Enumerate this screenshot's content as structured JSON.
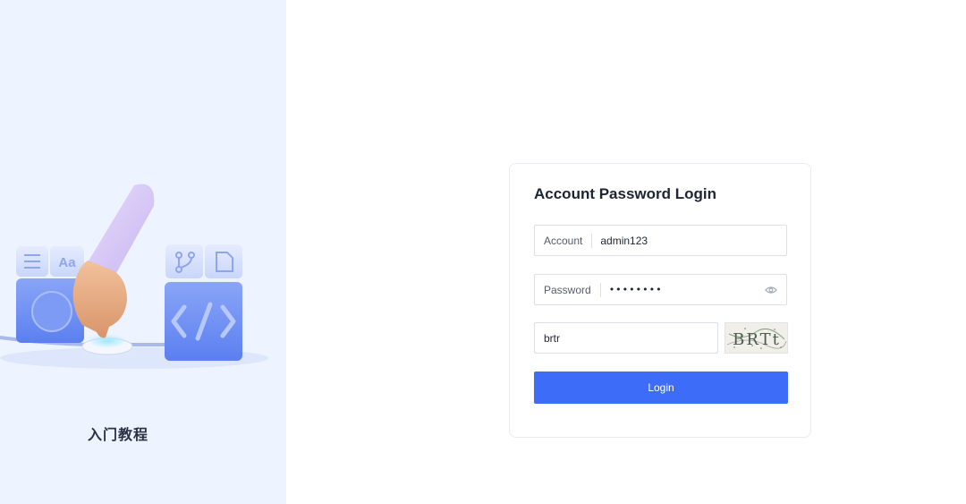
{
  "sidebar": {
    "caption": "入门教程",
    "illustration": {
      "tiles": [
        "list-icon",
        "text-aa-icon",
        "git-branch-icon",
        "file-icon",
        "code-icon",
        "circle-button-icon"
      ],
      "tile_text": "Aa",
      "accent": "#6f8ff5"
    }
  },
  "login": {
    "title": "Account Password Login",
    "account": {
      "label": "Account",
      "value": "admin123"
    },
    "password": {
      "label": "Password",
      "value": "••••••••"
    },
    "captcha": {
      "value": "brtr",
      "image_text": "BRTt"
    },
    "button_label": "Login"
  },
  "colors": {
    "primary": "#3c6cf8",
    "sidebar_bg": "#eef4ff",
    "border": "#dcdfe6"
  }
}
